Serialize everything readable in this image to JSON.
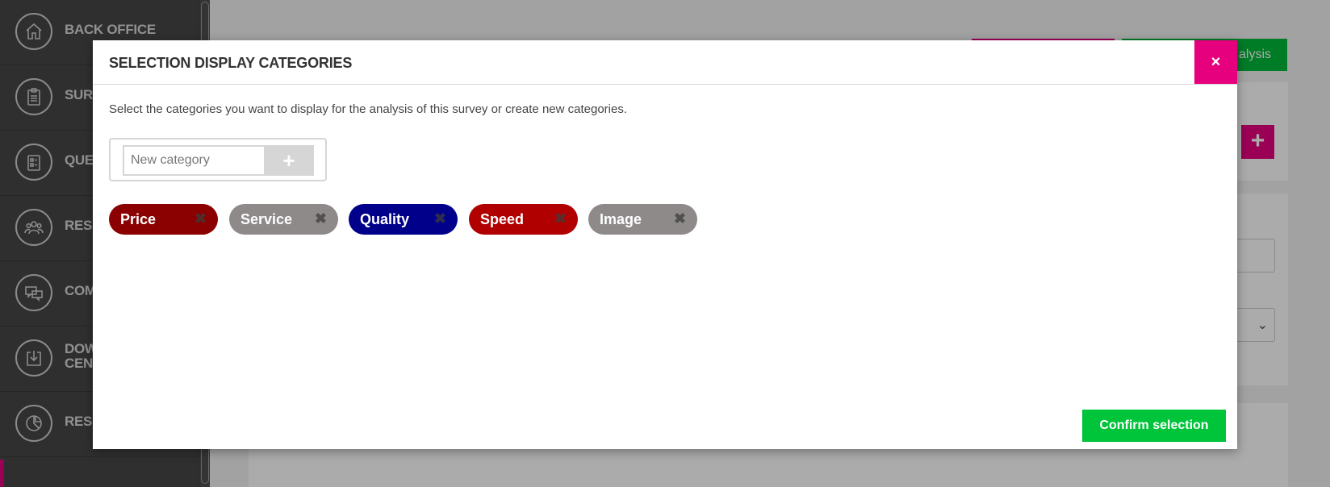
{
  "sidebar": {
    "items": [
      {
        "label": "BACK OFFICE",
        "icon": "home-icon"
      },
      {
        "label": "SUR",
        "icon": "clipboard-icon"
      },
      {
        "label": "QUE",
        "icon": "checklist-icon"
      },
      {
        "label": "RESI",
        "icon": "people-icon"
      },
      {
        "label": "COM",
        "icon": "comments-icon"
      },
      {
        "label": "DOW\nCEN",
        "icon": "download-icon"
      },
      {
        "label": "RESU",
        "icon": "pie-chart-icon"
      }
    ]
  },
  "background": {
    "analysis_button_label": "alysis"
  },
  "modal": {
    "title": "SELECTION DISPLAY CATEGORIES",
    "close_symbol": "×",
    "description": "Select the categories you want to display for the analysis of this survey or create new categories.",
    "new_category_placeholder": "New category",
    "add_symbol": "+",
    "confirm_label": "Confirm selection",
    "categories": [
      {
        "label": "Price",
        "color": "#8b0000",
        "remove_symbol": "✖"
      },
      {
        "label": "Service",
        "color": "#8e8a8a",
        "remove_symbol": "✖"
      },
      {
        "label": "Quality",
        "color": "#00008b",
        "remove_symbol": "✖"
      },
      {
        "label": "Speed",
        "color": "#b00000",
        "remove_symbol": "✖"
      },
      {
        "label": "Image",
        "color": "#8e8a8a",
        "remove_symbol": "✖"
      }
    ]
  },
  "colors": {
    "accent": "#e6007e",
    "confirm": "#00c43a",
    "sidebar": "#464646"
  }
}
